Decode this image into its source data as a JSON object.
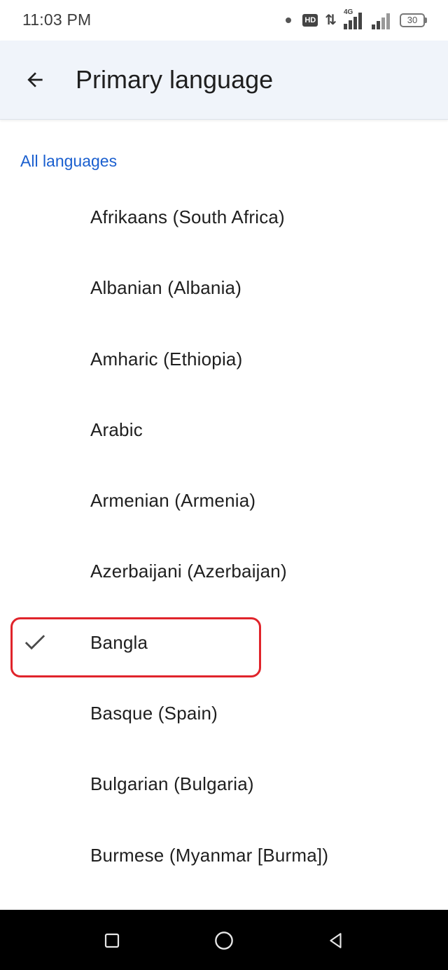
{
  "status_bar": {
    "time": "11:03 PM",
    "hd_label": "HD",
    "network_type": "4G",
    "battery_level": "30",
    "icons": [
      "notification-dot-icon",
      "hd-icon",
      "data-arrows-icon",
      "signal-4g-icon",
      "signal-icon",
      "battery-icon"
    ]
  },
  "app_bar": {
    "back_icon": "arrow-left-icon",
    "title": "Primary language"
  },
  "section": {
    "header": "All languages"
  },
  "languages": [
    {
      "label": "Afrikaans (South Africa)",
      "selected": false
    },
    {
      "label": "Albanian (Albania)",
      "selected": false
    },
    {
      "label": "Amharic (Ethiopia)",
      "selected": false
    },
    {
      "label": "Arabic",
      "selected": false
    },
    {
      "label": "Armenian (Armenia)",
      "selected": false
    },
    {
      "label": "Azerbaijani (Azerbaijan)",
      "selected": false
    },
    {
      "label": "Bangla",
      "selected": true
    },
    {
      "label": "Basque (Spain)",
      "selected": false
    },
    {
      "label": "Bulgarian (Bulgaria)",
      "selected": false
    },
    {
      "label": "Burmese (Myanmar [Burma])",
      "selected": false
    }
  ],
  "nav_bar": {
    "icons": [
      "recents-square-icon",
      "home-circle-icon",
      "back-triangle-icon"
    ]
  },
  "colors": {
    "accent": "#1a5fcf",
    "app_bar_bg": "#f0f4fa",
    "highlight_outline": "#e0242b",
    "nav_bar_bg": "#000000"
  }
}
